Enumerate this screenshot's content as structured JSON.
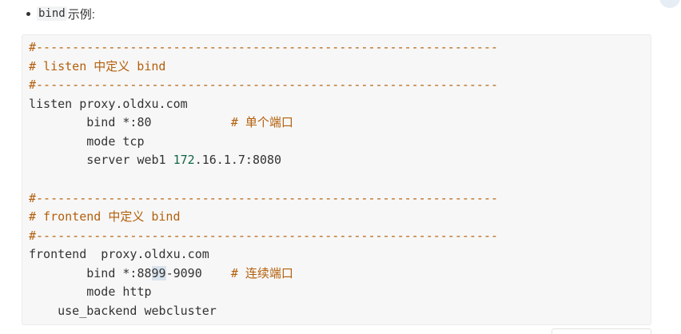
{
  "bullet": {
    "code": "bind",
    "text": "示例:"
  },
  "code_block": {
    "lines": [
      [
        "#----------------------------------------------------------------"
      ],
      [
        "# listen 中定义 bind"
      ],
      [
        "#----------------------------------------------------------------"
      ],
      [
        "listen proxy.oldxu.com"
      ],
      [
        "        bind *:80           ",
        "# 单个端口"
      ],
      [
        "        mode tcp"
      ],
      [
        "        server web1 ",
        "172",
        ".16.1.7:8080"
      ],
      [],
      [
        "#----------------------------------------------------------------"
      ],
      [
        "# frontend 中定义 bind"
      ],
      [
        "#----------------------------------------------------------------"
      ],
      [
        "frontend  proxy.oldxu.com"
      ],
      [
        "        bind *:88",
        "99",
        "-9090    ",
        "# 连续端口"
      ],
      [
        "        mode http"
      ],
      [
        "    use_backend webcluster"
      ]
    ]
  },
  "colors": {
    "comment": "#b35f0b",
    "number": "#116644",
    "text": "#333333",
    "code_bg": "#f7f7f7",
    "selection": "#d9e3ee"
  }
}
